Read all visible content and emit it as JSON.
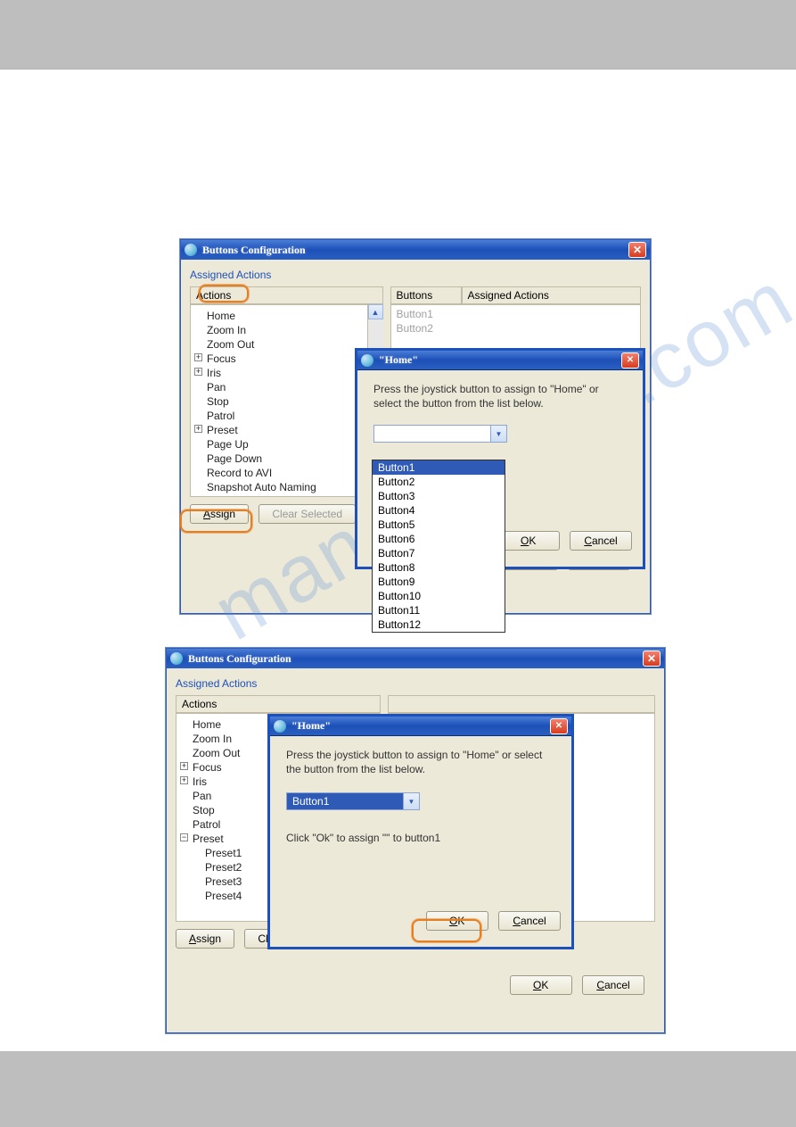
{
  "watermark": "manualshive.com",
  "window1": {
    "title": "Buttons Configuration",
    "groupLabel": "Assigned Actions",
    "actionsHeader": "Actions",
    "buttonsHeader": "Buttons",
    "assignedHeader": "Assigned Actions",
    "tree": [
      "Home",
      "Zoom In",
      "Zoom Out",
      "Focus",
      "Iris",
      "Pan",
      "Stop",
      "Patrol",
      "Preset",
      "Page Up",
      "Page Down",
      "Record to AVI",
      "Snapshot Auto Naming"
    ],
    "treeExpand": {
      "Focus": "+",
      "Iris": "+",
      "Preset": "+"
    },
    "rightList": [
      "Button1",
      "Button2"
    ],
    "assignBtn": "Assign",
    "clearBtn": "Clear Selected",
    "okBtn": "OK",
    "cancelBtn": "Cancel"
  },
  "modal1": {
    "title": "\"Home\"",
    "prompt": "Press the joystick button to assign to \"Home\" or select the button from the list below.",
    "comboSelected": "",
    "dropItems": [
      "Button1",
      "Button2",
      "Button3",
      "Button4",
      "Button5",
      "Button6",
      "Button7",
      "Button8",
      "Button9",
      "Button10",
      "Button11",
      "Button12"
    ],
    "okBtn": "OK",
    "cancelBtn": "Cancel"
  },
  "window2": {
    "title": "Buttons Configuration",
    "groupLabel": "Assigned Actions",
    "actionsHeader": "Actions",
    "tree": [
      "Home",
      "Zoom In",
      "Zoom Out",
      "Focus",
      "Iris",
      "Pan",
      "Stop",
      "Patrol",
      "Preset"
    ],
    "treeExpand": {
      "Focus": "+",
      "Iris": "+",
      "Preset": "-"
    },
    "presetChildren": [
      "Preset1",
      "Preset2",
      "Preset3",
      "Preset4"
    ],
    "assignBtn": "Assign",
    "clearBtn": "Clear Selected",
    "okBtn": "OK",
    "cancelBtn": "Cancel"
  },
  "modal2": {
    "title": "\"Home\"",
    "prompt": "Press the joystick button to assign to \"Home\" or select the button from the list below.",
    "comboSelected": "Button1",
    "confirmMsg": "Click \"Ok\" to assign \"\" to button1",
    "okBtn": "OK",
    "cancelBtn": "Cancel"
  }
}
